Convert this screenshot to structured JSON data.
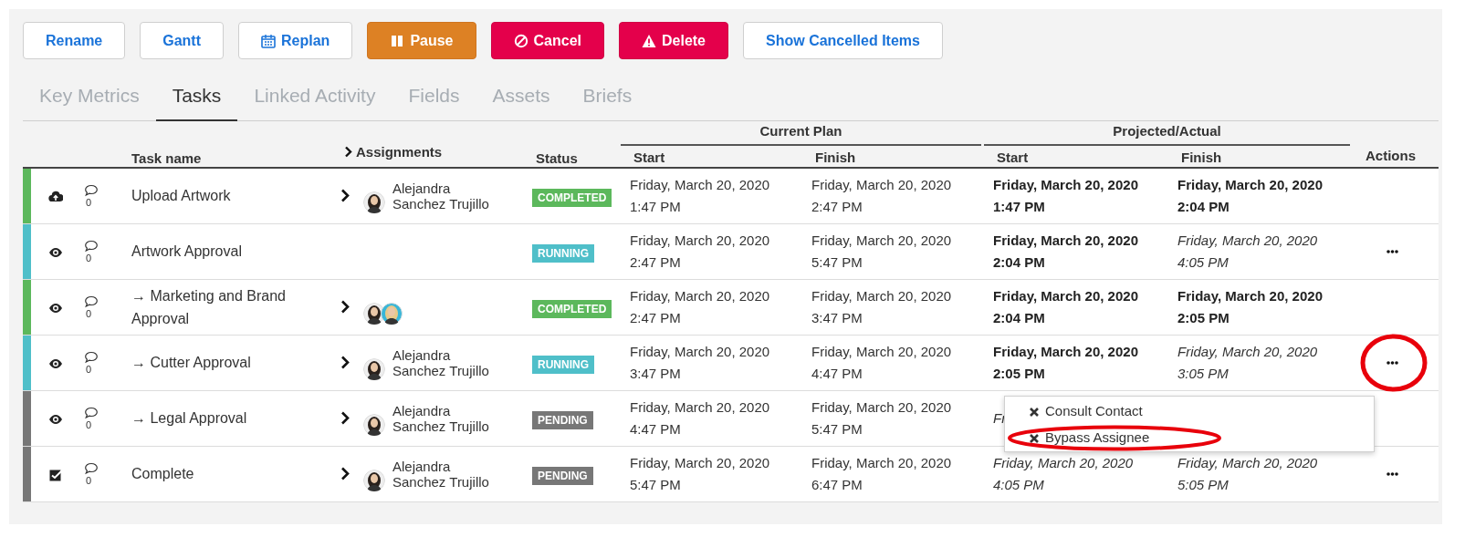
{
  "toolbar": [
    {
      "label": "Rename",
      "kind": "default"
    },
    {
      "label": "Gantt",
      "kind": "default"
    },
    {
      "label": "Replan",
      "kind": "default"
    },
    {
      "label": "Pause",
      "kind": "warning"
    },
    {
      "label": "Cancel",
      "kind": "danger"
    },
    {
      "label": "Delete",
      "kind": "danger"
    },
    {
      "label": "Show Cancelled Items",
      "kind": "default"
    }
  ],
  "tabs": [
    {
      "label": "Key Metrics",
      "selected": false
    },
    {
      "label": "Tasks",
      "selected": true
    },
    {
      "label": "Linked Activity",
      "selected": false
    },
    {
      "label": "Fields",
      "selected": false
    },
    {
      "label": "Assets",
      "selected": false
    },
    {
      "label": "Briefs",
      "selected": false
    }
  ],
  "table": {
    "group_headers": [
      "Current Plan",
      "Projected/Actual"
    ],
    "columns": [
      "Task name",
      "Assignments",
      "Status",
      "Start",
      "Finish",
      "Start",
      "Finish",
      "Actions"
    ],
    "rows": [
      {
        "color": "#5cb85c",
        "kind": "upload",
        "comments": "0",
        "task": "Upload Artwork",
        "assignee": "Alejandra Sanchez Trujillo",
        "avatars": [
          {
            "kind": "dark-hair"
          }
        ],
        "status": {
          "label": "COMPLETED",
          "color": "#5cb85c"
        },
        "plan_start": [
          "Friday, March 20, 2020",
          "1:47 PM"
        ],
        "plan_finish": [
          "Friday, March 20, 2020",
          "2:47 PM"
        ],
        "proj_start": {
          "text": [
            "Friday, March 20, 2020",
            "1:47 PM"
          ],
          "actual": true
        },
        "proj_finish": {
          "text": [
            "Friday, March 20, 2020",
            "2:04 PM"
          ],
          "actual": true
        },
        "actions": false,
        "actions_circled": false
      },
      {
        "color": "#4fbfc9",
        "kind": "view",
        "comments": "0",
        "task": "Artwork Approval",
        "avatars": [],
        "status": {
          "label": "RUNNING",
          "color": "#4fbfc9"
        },
        "plan_start": [
          "Friday, March 20, 2020",
          "2:47 PM"
        ],
        "plan_finish": [
          "Friday, March 20, 2020",
          "5:47 PM"
        ],
        "proj_start": {
          "text": [
            "Friday, March 20, 2020",
            "2:04 PM"
          ],
          "actual": true
        },
        "proj_finish": {
          "text": [
            "Friday, March 20, 2020",
            "4:05 PM"
          ],
          "actual": false
        },
        "actions": true,
        "actions_circled": false
      },
      {
        "color": "#5cb85c",
        "kind": "view",
        "comments": "0",
        "task": "→ Marketing and Brand Approval",
        "avatars": [
          {
            "kind": "dark-hair"
          },
          {
            "kind": "light-hair"
          }
        ],
        "status": {
          "label": "COMPLETED",
          "color": "#5cb85c"
        },
        "plan_start": [
          "Friday, March 20, 2020",
          "2:47 PM"
        ],
        "plan_finish": [
          "Friday, March 20, 2020",
          "3:47 PM"
        ],
        "proj_start": {
          "text": [
            "Friday, March 20, 2020",
            "2:04 PM"
          ],
          "actual": true
        },
        "proj_finish": {
          "text": [
            "Friday, March 20, 2020",
            "2:05 PM"
          ],
          "actual": true
        },
        "actions": false,
        "actions_circled": false
      },
      {
        "color": "#4fbfc9",
        "kind": "view",
        "comments": "0",
        "task": "→ Cutter Approval",
        "assignee": "Alejandra Sanchez Trujillo",
        "avatars": [
          {
            "kind": "dark-hair"
          }
        ],
        "status": {
          "label": "RUNNING",
          "color": "#4fbfc9"
        },
        "plan_start": [
          "Friday, March 20, 2020",
          "3:47 PM"
        ],
        "plan_finish": [
          "Friday, March 20, 2020",
          "4:47 PM"
        ],
        "proj_start": {
          "text": [
            "Friday, March 20, 2020",
            "2:05 PM"
          ],
          "actual": true
        },
        "proj_finish": {
          "text": [
            "Friday, March 20, 2020",
            "3:05 PM"
          ],
          "actual": false
        },
        "actions": true,
        "actions_circled": true
      },
      {
        "color": "#777777",
        "kind": "view",
        "comments": "0",
        "task": "→ Legal Approval",
        "assignee": "Alejandra Sanchez Trujillo",
        "avatars": [
          {
            "kind": "dark-hair"
          }
        ],
        "status": {
          "label": "PENDING",
          "color": "#777777"
        },
        "plan_start": [
          "Friday, March 20, 2020",
          "4:47 PM"
        ],
        "plan_finish": [
          "Friday, March 20, 2020",
          "5:47 PM"
        ],
        "proj_start": {
          "text": [
            "Fr"
          ],
          "actual": false
        },
        "actions": false,
        "actions_circled": false
      },
      {
        "color": "#777777",
        "kind": "done",
        "comments": "0",
        "task": "Complete",
        "assignee": "Alejandra Sanchez Trujillo",
        "avatars": [
          {
            "kind": "dark-hair"
          }
        ],
        "status": {
          "label": "PENDING",
          "color": "#777777"
        },
        "plan_start": [
          "Friday, March 20, 2020",
          "5:47 PM"
        ],
        "plan_finish": [
          "Friday, March 20, 2020",
          "6:47 PM"
        ],
        "proj_start": {
          "text": [
            "Friday, March 20, 2020",
            "4:05 PM"
          ],
          "actual": false
        },
        "proj_finish": {
          "text": [
            "Friday, March 20, 2020",
            "5:05 PM"
          ],
          "actual": false
        },
        "actions": true,
        "actions_circled": false
      }
    ]
  },
  "menu": {
    "items": [
      {
        "label": "Consult Contact",
        "circled": false
      },
      {
        "label": "Bypass Assignee",
        "circled": true
      }
    ]
  }
}
